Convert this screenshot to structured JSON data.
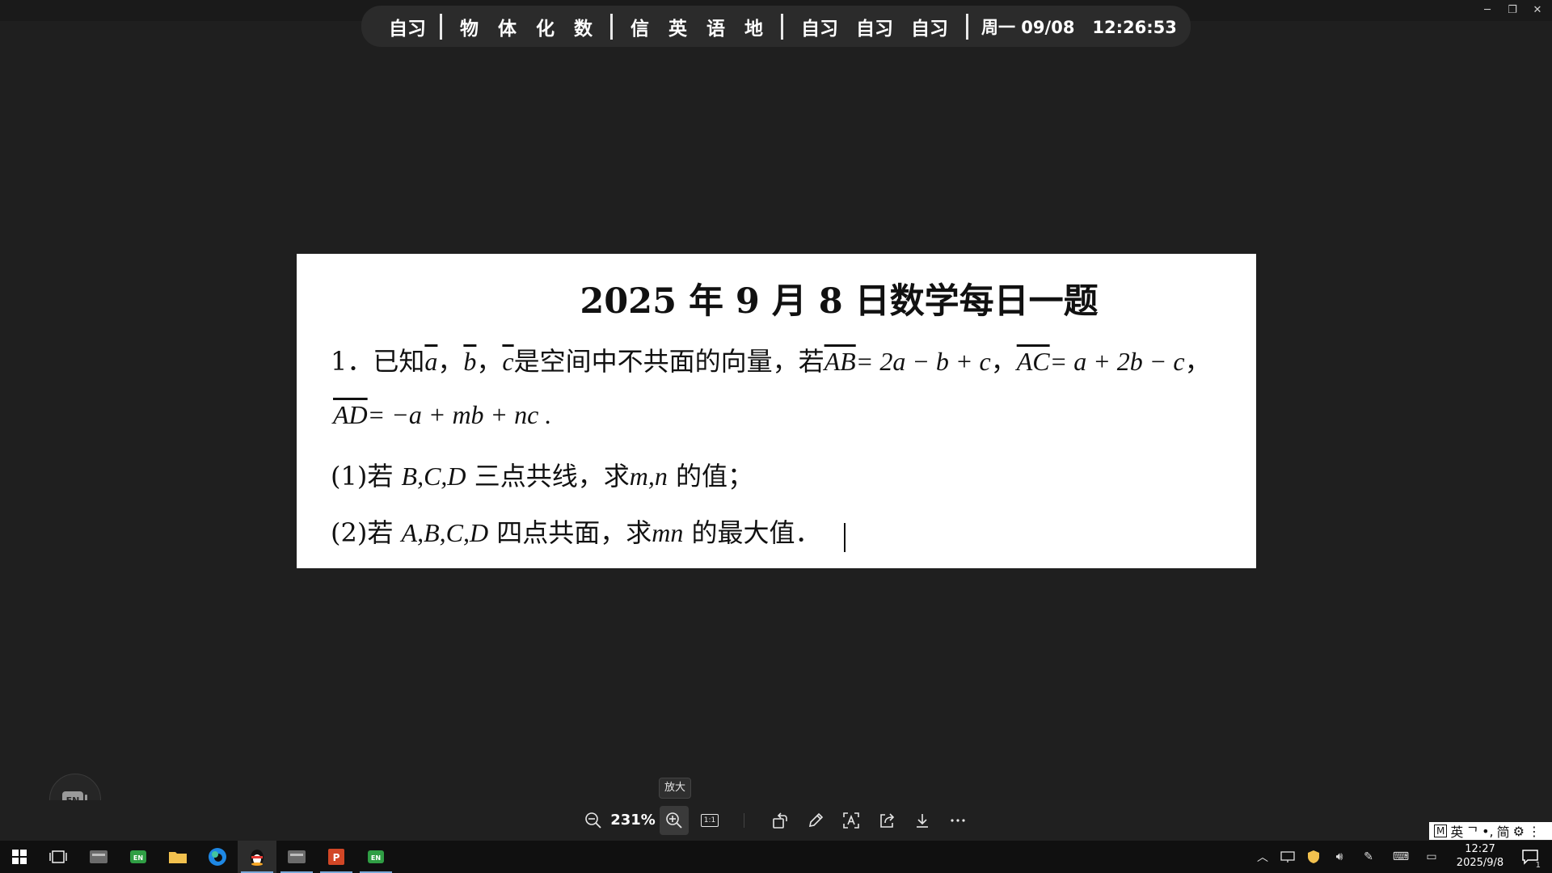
{
  "schedule": {
    "group1": [
      "自习"
    ],
    "group2": [
      "物",
      "体",
      "化",
      "数"
    ],
    "group3": [
      "信",
      "英",
      "语",
      "地"
    ],
    "group4": [
      "自习",
      "自习",
      "自习"
    ],
    "clock": "周一 09/08   12:26:53"
  },
  "window": {
    "minimize_icon": "minimize-icon",
    "restore_icon": "restore-icon",
    "close_icon": "close-icon"
  },
  "document": {
    "title": "2025 年 9 月 8 日数学每日一题",
    "q1_prefix": "1．已知",
    "q1_a": "a",
    "sep1": "，",
    "q1_b": "b",
    "sep2": "，",
    "q1_c": "c",
    "q1_mid": "是空间中不共面的向量，若",
    "q1_eq1_lhs": "AB",
    "q1_eq1_rhs": "= 2a − b + c",
    "sep3": "，",
    "q1_eq2_lhs": "AC",
    "q1_eq2_rhs": "= a + 2b − c",
    "sep4": "，",
    "q1_eq3_lhs": "AD",
    "q1_eq3_rhs": "= −a + mb + nc .",
    "part1_a": "(1)若 ",
    "part1_points": "B,C,D",
    "part1_b": " 三点共线，求",
    "part1_vars": "m,n",
    "part1_c": " 的值；",
    "part2_a": "(2)若 ",
    "part2_points": "A,B,C,D",
    "part2_b": " 四点共面，求",
    "part2_vars": "mn",
    "part2_c": " 的最大值．"
  },
  "tooltip": "放大",
  "toolbar": {
    "zoom_level": "231%",
    "one_to_one": "1:1"
  },
  "ime": [
    "M",
    "英",
    "ᄀ",
    "•,",
    "简",
    "⚙",
    "⋮"
  ],
  "tray": {
    "time": "12:27",
    "date": "2025/9/8",
    "notification_count": "1"
  }
}
